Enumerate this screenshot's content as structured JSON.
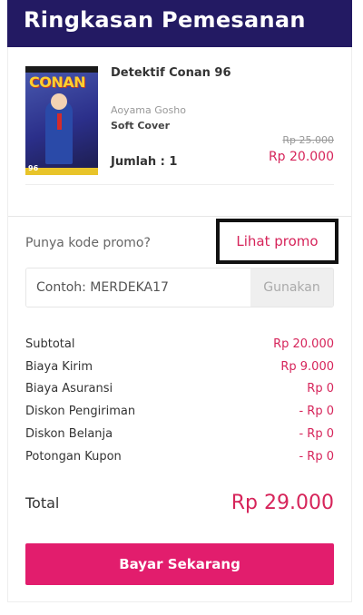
{
  "header": {
    "title": "Ringkasan Pemesanan"
  },
  "product": {
    "cover_logo": "CONAN",
    "cover_volume": "96",
    "title": "Detektif Conan 96",
    "author": "Aoyama Gosho",
    "format": "Soft Cover",
    "quantity": "Jumlah : 1",
    "price_original": "Rp 25.000",
    "price_final": "Rp 20.000"
  },
  "promo": {
    "question": "Punya kode promo?",
    "link_label": "Lihat promo",
    "placeholder": "Contoh: MERDEKA17",
    "apply_label": "Gunakan"
  },
  "summary": {
    "rows": [
      {
        "label": "Subtotal",
        "value": "Rp 20.000"
      },
      {
        "label": "Biaya Kirim",
        "value": "Rp 9.000"
      },
      {
        "label": "Biaya Asuransi",
        "value": "Rp 0"
      },
      {
        "label": "Diskon Pengiriman",
        "value": "- Rp 0"
      },
      {
        "label": "Diskon Belanja",
        "value": "- Rp 0"
      },
      {
        "label": "Potongan Kupon",
        "value": "- Rp 0"
      }
    ],
    "total_label": "Total",
    "total_value": "Rp 29.000"
  },
  "actions": {
    "pay_label": "Bayar Sekarang"
  },
  "colors": {
    "header_bg": "#231a63",
    "accent": "#d6245a",
    "pay_button": "#e21d6d",
    "highlight_border": "#111111"
  }
}
